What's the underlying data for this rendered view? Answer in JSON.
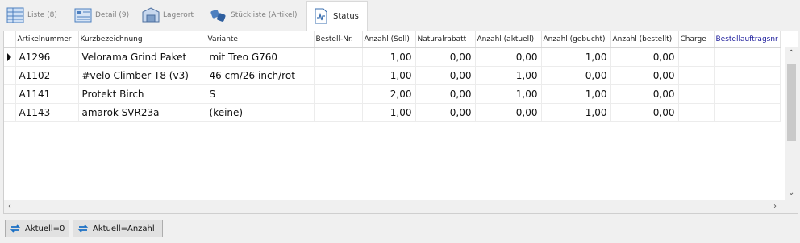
{
  "tabs": [
    {
      "label": "Liste (8)",
      "icon": "grid-list-icon"
    },
    {
      "label": "Detail (9)",
      "icon": "detail-card-icon"
    },
    {
      "label": "Lagerort",
      "icon": "warehouse-icon"
    },
    {
      "label": "Stückliste (Artikel)",
      "icon": "parts-list-icon"
    },
    {
      "label": "Status",
      "icon": "status-chart-icon",
      "active": true
    }
  ],
  "columns": [
    "Artikelnummer",
    "Kurzbezeichnung",
    "Variante",
    "Bestell-Nr.",
    "Anzahl (Soll)",
    "Naturalrabatt",
    "Anzahl (aktuell)",
    "Anzahl (gebucht)",
    "Anzahl (bestellt)",
    "Charge",
    "Bestellauftragsnr"
  ],
  "rows": [
    {
      "artikelnummer": "A1296",
      "kurzbezeichnung": "Velorama Grind Paket",
      "variante": "mit Treo G760",
      "bestellnr": "",
      "soll": "1,00",
      "naturalrabatt": "0,00",
      "aktuell": "0,00",
      "gebucht": "1,00",
      "bestellt": "0,00",
      "charge": "",
      "bestellauftrag": ""
    },
    {
      "artikelnummer": "A1102",
      "kurzbezeichnung": "#velo Climber T8 (v3)",
      "variante": "46 cm/26 inch/rot",
      "bestellnr": "",
      "soll": "1,00",
      "naturalrabatt": "0,00",
      "aktuell": "1,00",
      "gebucht": "0,00",
      "bestellt": "0,00",
      "charge": "",
      "bestellauftrag": ""
    },
    {
      "artikelnummer": "A1141",
      "kurzbezeichnung": "Protekt Birch",
      "variante": "S",
      "bestellnr": "",
      "soll": "2,00",
      "naturalrabatt": "0,00",
      "aktuell": "1,00",
      "gebucht": "1,00",
      "bestellt": "0,00",
      "charge": "",
      "bestellauftrag": ""
    },
    {
      "artikelnummer": "A1143",
      "kurzbezeichnung": "amarok SVR23a",
      "variante": "(keine)",
      "bestellnr": "",
      "soll": "1,00",
      "naturalrabatt": "0,00",
      "aktuell": "0,00",
      "gebucht": "1,00",
      "bestellt": "0,00",
      "charge": "",
      "bestellauftrag": ""
    }
  ],
  "buttons": [
    {
      "label": "Aktuell=0",
      "icon": "refresh-icon"
    },
    {
      "label": "Aktuell=Anzahl",
      "icon": "refresh-icon"
    }
  ],
  "colors": {
    "accent": "#1a6fc4",
    "header_blue": "#1a1a9a"
  }
}
